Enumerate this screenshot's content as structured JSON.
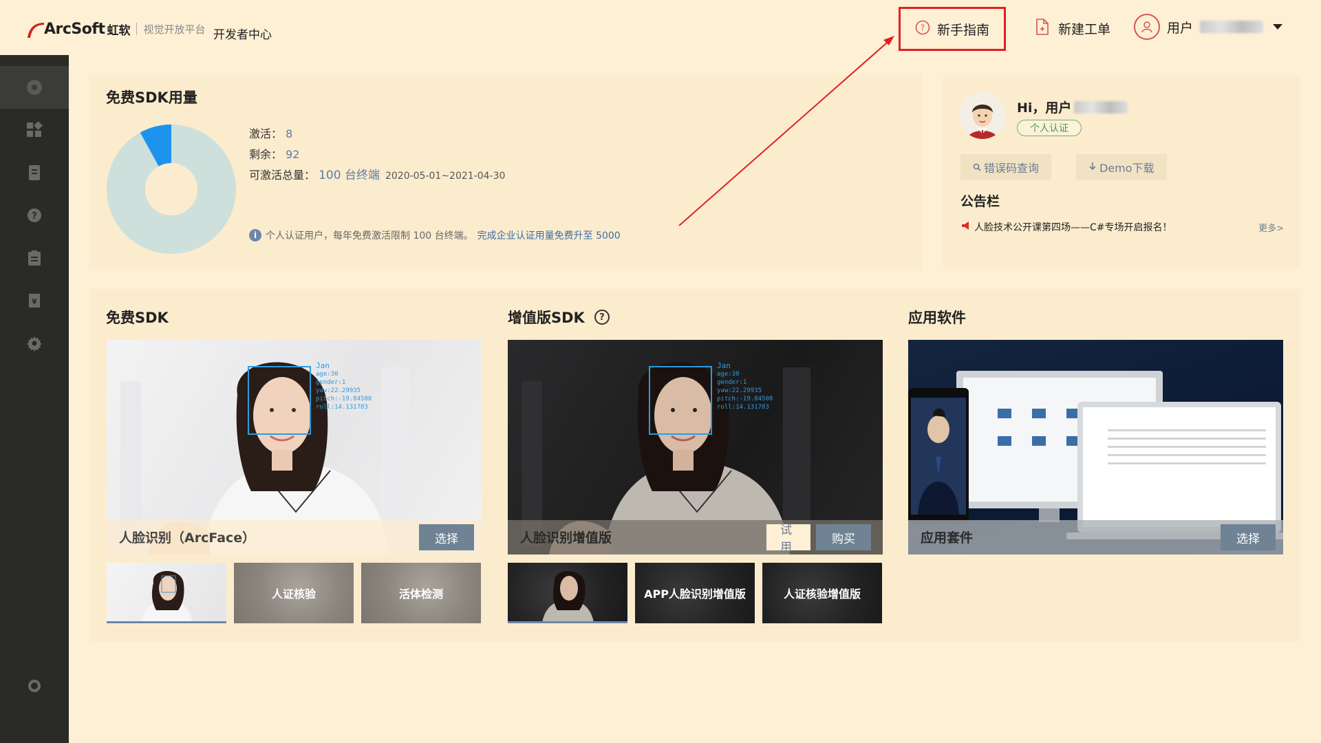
{
  "header": {
    "logo_brand": "ArcSoft",
    "logo_cn": "虹软",
    "logo_sub": "视觉开放平台",
    "dev_center": "开发者中心",
    "guide_label": "新手指南",
    "new_ticket_label": "新建工单",
    "user_label": "用户"
  },
  "sidebar": {
    "items": [
      {
        "icon": "dashboard-icon"
      },
      {
        "icon": "apps-grid-icon"
      },
      {
        "icon": "document-icon"
      },
      {
        "icon": "help-icon"
      },
      {
        "icon": "clipboard-icon"
      },
      {
        "icon": "invoice-icon"
      },
      {
        "icon": "settings-gear-icon"
      },
      {
        "icon": "support-headset-icon"
      }
    ]
  },
  "usage": {
    "title": "免费SDK用量",
    "activated_label": "激活：",
    "activated_value": "8",
    "remaining_label": "剩余：",
    "remaining_value": "92",
    "total_label": "可激活总量：",
    "total_value": "100 台终端",
    "date_range": "2020-05-01~2021-04-30",
    "note_text": "个人认证用户，每年免费激活限制 100 台终端。",
    "note_link": "完成企业认证用量免费升至 5000",
    "chart": {
      "activated": 8,
      "remaining": 92,
      "activated_color": "#1e93ee",
      "remaining_color": "#cde0dc"
    }
  },
  "profile": {
    "greeting": "Hi，用户",
    "cert_badge": "个人认证",
    "error_code_btn": "错误码查询",
    "demo_btn": "Demo下载",
    "notice_title": "公告栏",
    "notice_item": "人脸技术公开课第四场——C#专场开启报名！",
    "notice_more": "更多>"
  },
  "free_sdk": {
    "title": "免费SDK",
    "hero_label": "人脸识别（ArcFace）",
    "select_btn": "选择",
    "thumbs": [
      "人证核验",
      "活体检测"
    ]
  },
  "vip_sdk": {
    "title": "增值版SDK",
    "hero_label": "人脸识别增值版",
    "trial_btn": "试用",
    "buy_btn": "购买",
    "thumbs": [
      "APP人脸识别增值版",
      "人证核验增值版"
    ]
  },
  "app_software": {
    "title": "应用软件",
    "hero_label": "应用套件",
    "select_btn": "选择"
  },
  "hud": {
    "name": "Jan",
    "lines": [
      "age:30",
      "gender:1",
      "yaw:22.29935",
      "pitch:-19.84508",
      "roll:14.131783"
    ]
  }
}
